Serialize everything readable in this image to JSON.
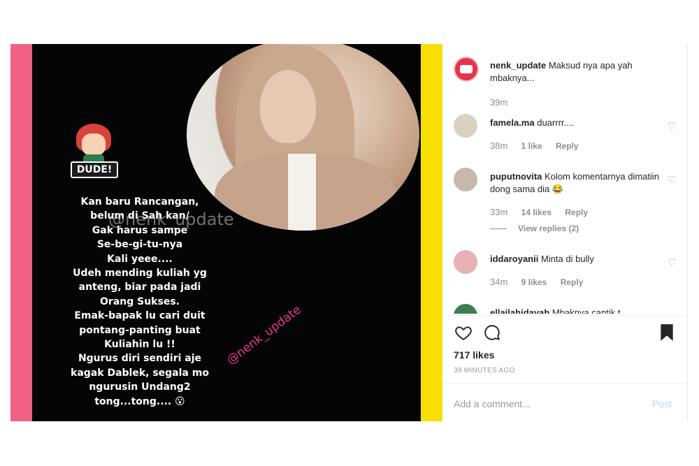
{
  "story": {
    "sticker_text": "DUDE!",
    "lines": [
      "Kan baru Rancangan,",
      "belum di Sah kan/",
      "Gak harus sampe",
      "Se-be-gi-tu-nya",
      "Kali yeee....",
      "Udeh mending kuliah yg",
      "anteng, biar pada jadi",
      "Orang Sukses.",
      "Emak-bapak lu cari duit",
      "pontang-panting buat",
      "Kuliahin lu !!",
      "Ngurus diri sendiri aje",
      "kagak Dablek, segala mo",
      "ngurusin Undang2",
      "tong...tong.... 😮"
    ],
    "watermark_center": "@nenk_update",
    "watermark_diagonal": "@nenk_update"
  },
  "caption": {
    "username": "nenk_update",
    "text": "Maksud nya apa yah mbaknya...",
    "time": "39m"
  },
  "comments": [
    {
      "username": "famela.ma",
      "text": "duarrrr....",
      "time": "38m",
      "likes": "1 like",
      "reply": "Reply"
    },
    {
      "username": "puputnovita",
      "text": "Kolom komentarnya dimatiin dong sama dia 😂",
      "time": "33m",
      "likes": "14 likes",
      "reply": "Reply",
      "view_replies": "View replies (2)"
    },
    {
      "username": "iddaroyanii",
      "text": "Minta di bully",
      "time": "34m",
      "likes": "9 likes",
      "reply": "Reply"
    },
    {
      "username": "ellailahidayah",
      "text": "Mbaknya cantik t..."
    }
  ],
  "footer": {
    "likes": "717 likes",
    "time_ago": "39 MINUTES AGO",
    "add_comment_placeholder": "Add a comment...",
    "post_label": "Post"
  },
  "icons": {
    "like": "heart-icon",
    "comment": "comment-icon",
    "save": "bookmark-icon"
  },
  "colors": {
    "pink_bar": "#f06283",
    "yellow_bar": "#f7e000",
    "watermark_pink": "#e8388f"
  }
}
